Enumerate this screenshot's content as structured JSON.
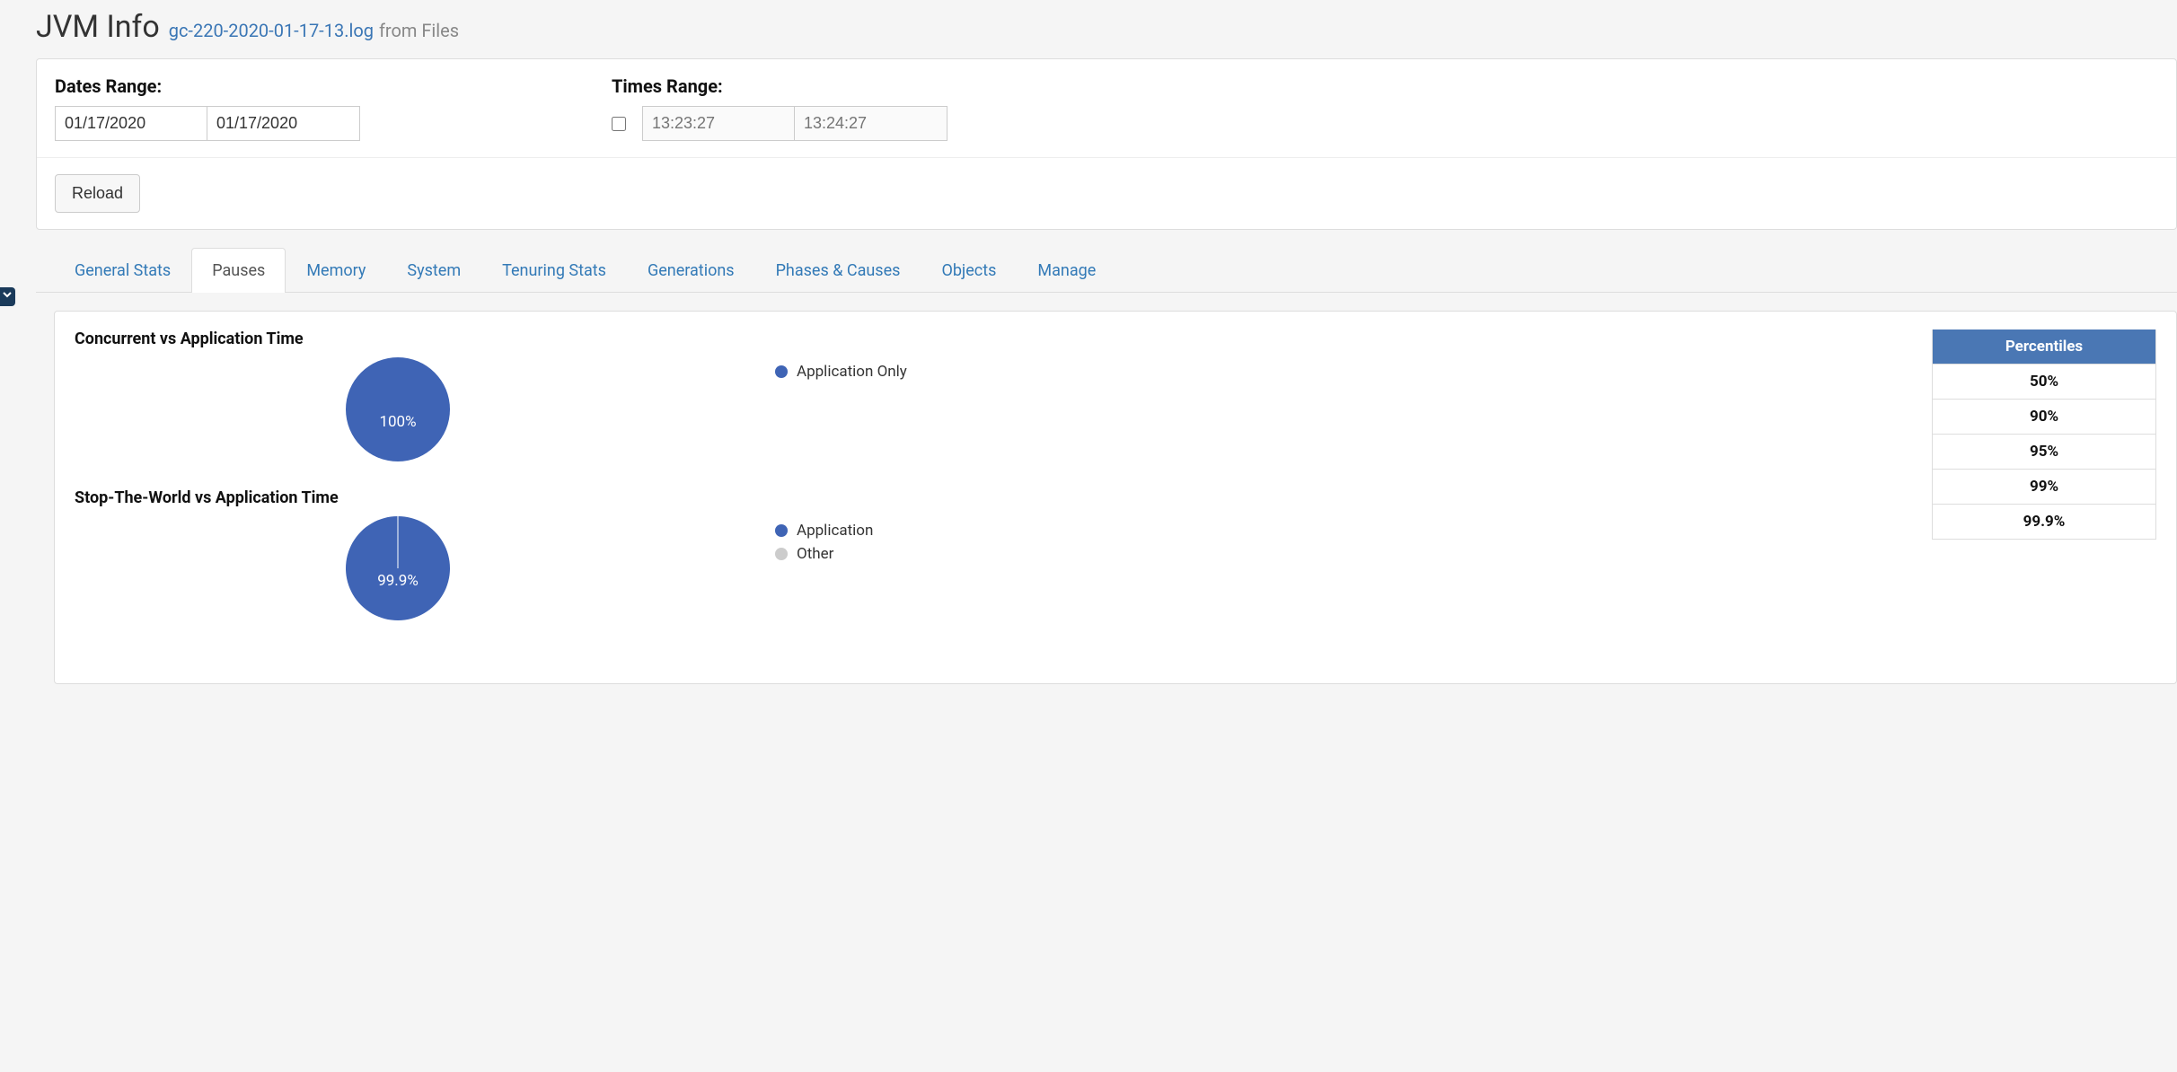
{
  "header": {
    "title": "JVM Info",
    "file_link": "gc-220-2020-01-17-13.log",
    "suffix": "from Files"
  },
  "filters": {
    "dates_label": "Dates Range:",
    "times_label": "Times Range:",
    "date_from": "01/17/2020",
    "date_to": "01/17/2020",
    "time_from_placeholder": "13:23:27",
    "time_to_placeholder": "13:24:27",
    "reload_label": "Reload"
  },
  "tabs": [
    {
      "id": "general",
      "label": "General Stats",
      "active": false
    },
    {
      "id": "pauses",
      "label": "Pauses",
      "active": true
    },
    {
      "id": "memory",
      "label": "Memory",
      "active": false
    },
    {
      "id": "system",
      "label": "System",
      "active": false
    },
    {
      "id": "tenuring",
      "label": "Tenuring Stats",
      "active": false
    },
    {
      "id": "generations",
      "label": "Generations",
      "active": false
    },
    {
      "id": "phases",
      "label": "Phases & Causes",
      "active": false
    },
    {
      "id": "objects",
      "label": "Objects",
      "active": false
    },
    {
      "id": "manage",
      "label": "Manage",
      "active": false
    }
  ],
  "percentiles": {
    "header": "Percentiles",
    "rows": [
      "50%",
      "90%",
      "95%",
      "99%",
      "99.9%"
    ]
  },
  "chart_data": [
    {
      "type": "pie",
      "title": "Concurrent vs Application Time",
      "series": [
        {
          "name": "Application Only",
          "value": 100,
          "color": "#3f64b5",
          "label": "100%"
        }
      ]
    },
    {
      "type": "pie",
      "title": "Stop-The-World vs Application Time",
      "series": [
        {
          "name": "Application",
          "value": 99.9,
          "color": "#3f64b5",
          "label": "99.9%"
        },
        {
          "name": "Other",
          "value": 0.1,
          "color": "#cccccc",
          "label": ""
        }
      ]
    }
  ]
}
